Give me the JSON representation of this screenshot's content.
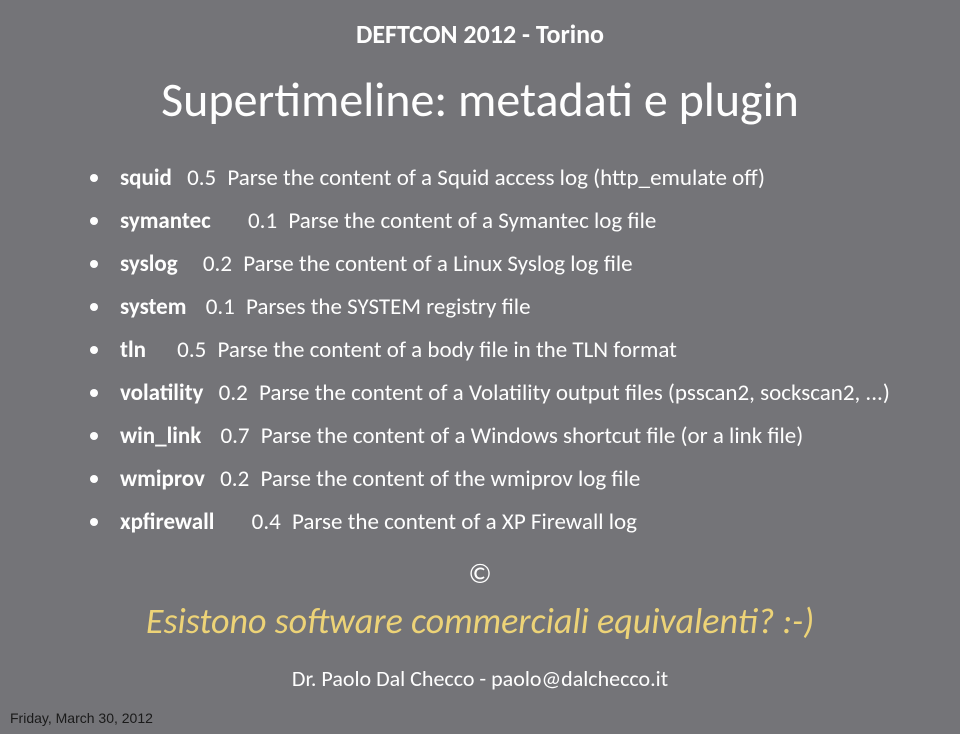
{
  "header": "DEFTCON 2012 - Torino",
  "title": "Supertimeline: metadati e plugin",
  "plugins": [
    {
      "name": "squid",
      "version": "0.5",
      "desc": "Parse the content of a Squid access log (http_emulate off)"
    },
    {
      "name": "symantec",
      "version": "0.1",
      "desc": "Parse the content of a Symantec log file"
    },
    {
      "name": "syslog",
      "version": "0.2",
      "desc": "Parse the content of a Linux Syslog log file"
    },
    {
      "name": "system",
      "version": "0.1",
      "desc": "Parses the SYSTEM registry file"
    },
    {
      "name": "tln",
      "version": "0.5",
      "desc": "Parse the content of a body file in the TLN format"
    },
    {
      "name": "volatility",
      "version": "0.2",
      "desc": "Parse the content of a Volatility output files (psscan2, sockscan2, ...)"
    },
    {
      "name": "win_link",
      "version": "0.7",
      "desc": "Parse the content of a Windows shortcut file (or a link file)"
    },
    {
      "name": "wmiprov",
      "version": "0.2",
      "desc": "Parse the content of the wmiprov log file"
    },
    {
      "name": "xpfirewall",
      "version": "0.4",
      "desc": "Parse the content of a XP Firewall log"
    }
  ],
  "copyright_symbol": "©",
  "footer_question": "Esistono software commerciali equivalenti? :-)",
  "author": "Dr. Paolo Dal Checco - paolo@dalchecco.it",
  "date": "Friday, March 30, 2012"
}
